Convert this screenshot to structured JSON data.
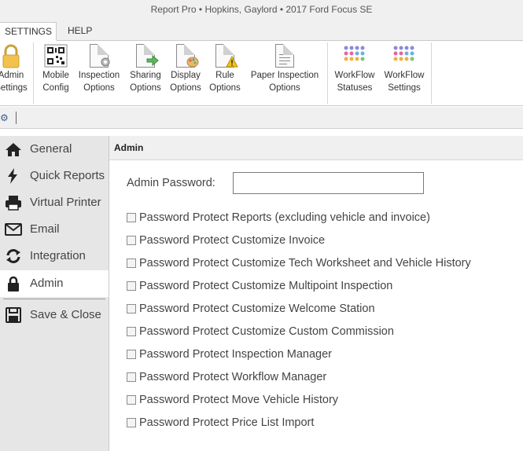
{
  "window": {
    "title": "Report Pro • Hopkins, Gaylord • 2017 Ford Focus SE"
  },
  "menu": {
    "tabs": [
      {
        "label": "SETTINGS",
        "active": true
      },
      {
        "label": "HELP"
      }
    ]
  },
  "ribbon": {
    "buttons": [
      {
        "label": "Admin\nSettings",
        "icon": "lock-icon"
      },
      {
        "label": "Mobile\nConfig",
        "icon": "qr-code-icon"
      },
      {
        "label": "Inspection\nOptions",
        "icon": "inspection-options-icon"
      },
      {
        "label": "Sharing\nOptions",
        "icon": "sharing-options-icon"
      },
      {
        "label": "Display\nOptions",
        "icon": "display-options-icon"
      },
      {
        "label": "Rule\nOptions",
        "icon": "rule-options-icon"
      },
      {
        "label": "Paper Inspection\nOptions",
        "icon": "paper-inspection-icon"
      },
      {
        "label": "WorkFlow\nStatuses",
        "icon": "workflow-statuses-icon"
      },
      {
        "label": "WorkFlow\nSettings",
        "icon": "workflow-settings-icon"
      }
    ]
  },
  "sidebar": {
    "items": [
      {
        "label": "General",
        "icon": "home-icon"
      },
      {
        "label": "Quick Reports",
        "icon": "lightning-icon"
      },
      {
        "label": "Virtual Printer",
        "icon": "printer-icon"
      },
      {
        "label": "Email",
        "icon": "envelope-icon"
      },
      {
        "label": "Integration",
        "icon": "sync-icon"
      },
      {
        "label": "Admin",
        "icon": "lock-icon",
        "active": true
      },
      {
        "label": "Save & Close",
        "icon": "save-icon"
      }
    ]
  },
  "admin": {
    "section_title": "Admin",
    "password_label": "Admin Password:",
    "password_value": "",
    "checkboxes": [
      {
        "label": "Password Protect Reports (excluding vehicle and invoice)",
        "checked": false
      },
      {
        "label": "Password Protect Customize Invoice",
        "checked": false
      },
      {
        "label": "Password Protect Customize Tech Worksheet and Vehicle History",
        "checked": false
      },
      {
        "label": "Password Protect Customize Multipoint Inspection",
        "checked": false
      },
      {
        "label": "Password Protect Customize Welcome Station",
        "checked": false
      },
      {
        "label": "Password Protect Customize Custom Commission",
        "checked": false
      },
      {
        "label": "Password Protect Inspection Manager",
        "checked": false
      },
      {
        "label": "Password Protect Workflow Manager",
        "checked": false
      },
      {
        "label": "Password Protect Move Vehicle History",
        "checked": false
      },
      {
        "label": "Password Protect Price List Import",
        "checked": false
      }
    ]
  }
}
